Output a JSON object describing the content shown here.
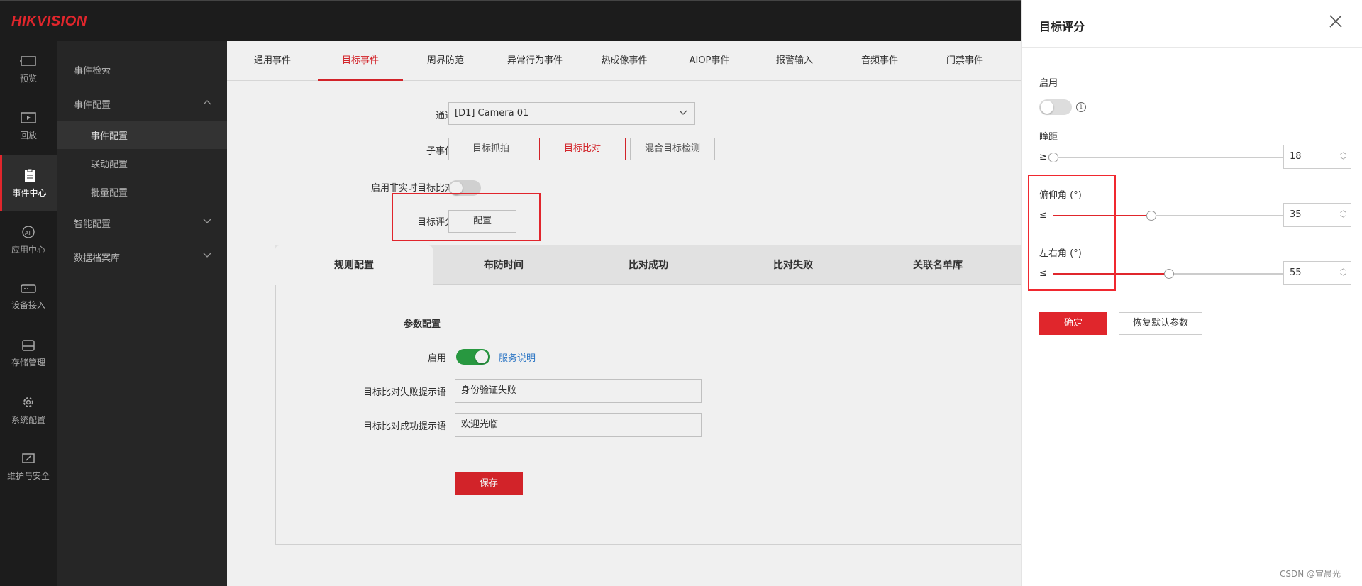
{
  "brand": {
    "logo": "HIKVISION"
  },
  "nav": {
    "items": [
      {
        "label": "预览",
        "icon": "monitor-icon"
      },
      {
        "label": "回放",
        "icon": "play-icon"
      },
      {
        "label": "事件中心",
        "icon": "clipboard-icon"
      },
      {
        "label": "应用中心",
        "icon": "ai-icon"
      },
      {
        "label": "设备接入",
        "icon": "device-icon"
      },
      {
        "label": "存储管理",
        "icon": "storage-icon"
      },
      {
        "label": "系统配置",
        "icon": "gear-icon"
      },
      {
        "label": "维护与安全",
        "icon": "shield-icon"
      }
    ]
  },
  "subnav": {
    "event_search": "事件检索",
    "event_config": "事件配置",
    "event_config_child": "事件配置",
    "linkage_config": "联动配置",
    "batch_config": "批量配置",
    "smart_config": "智能配置",
    "archive_db": "数据档案库"
  },
  "tabs": [
    "通用事件",
    "目标事件",
    "周界防范",
    "异常行为事件",
    "热成像事件",
    "AIOP事件",
    "报警输入",
    "音频事件",
    "门禁事件"
  ],
  "form": {
    "channel_label": "通道",
    "channel_value": "[D1] Camera 01",
    "subevent_label": "子事件",
    "subevents": [
      "目标抓拍",
      "目标比对",
      "混合目标检测"
    ],
    "nonrealtime_label": "启用非实时目标比对",
    "score_label": "目标评分",
    "score_button": "配置"
  },
  "subtabs": [
    "规则配置",
    "布防时间",
    "比对成功",
    "比对失败",
    "关联名单库"
  ],
  "panel": {
    "section_title": "参数配置",
    "enable_label": "启用",
    "service_link": "服务说明",
    "fail_label": "目标比对失败提示语",
    "fail_value": "身份验证失败",
    "success_label": "目标比对成功提示语",
    "success_value": "欢迎光临",
    "save_button": "保存"
  },
  "drawer": {
    "title": "目标评分",
    "enable_label": "启用",
    "info_symbol": "i",
    "pupil_label": "瞳距",
    "pupil_op": "≥",
    "pupil_value": "18",
    "pupil_level": 0.0,
    "pitch_label": "俯仰角 (°)",
    "pitch_op": "≤",
    "pitch_value": "35",
    "pitch_level": 0.39,
    "yaw_label": "左右角 (°)",
    "yaw_op": "≤",
    "yaw_value": "55",
    "yaw_level": 0.46,
    "confirm_button": "确定",
    "restore_button": "恢复默认参数"
  },
  "watermark": "CSDN @宣晨光",
  "colors": {
    "accent": "#e0262c",
    "toggle_on": "#2ba245",
    "link": "#2e7dd1",
    "sidebar": "#1c1c1c"
  }
}
